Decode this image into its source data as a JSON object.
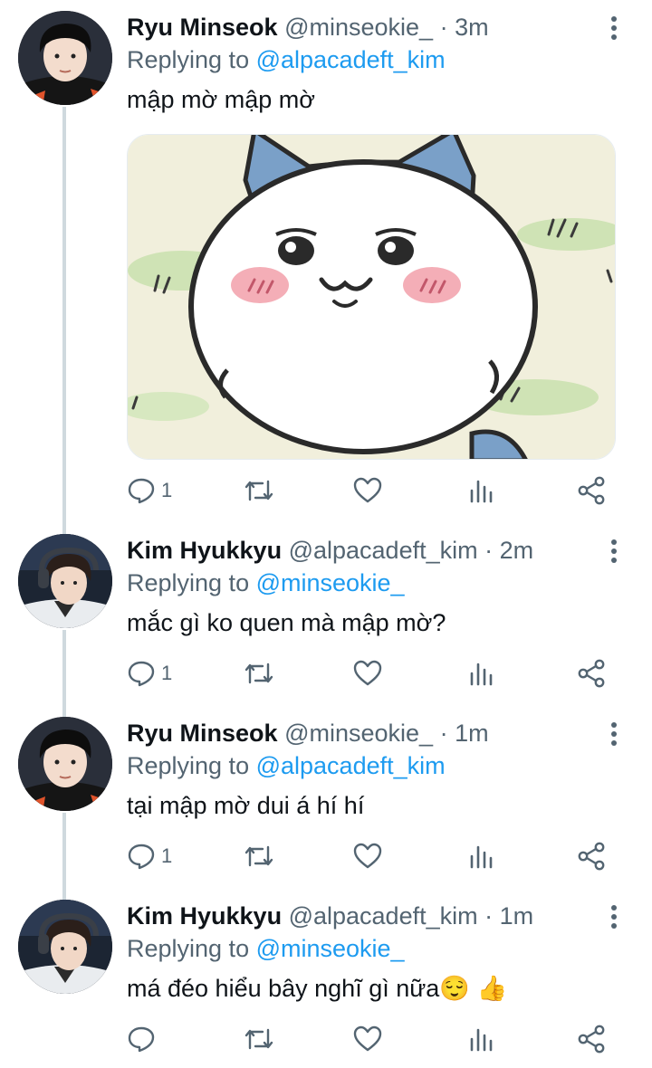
{
  "tweets": [
    {
      "name": "Ryu Minseok",
      "handle": "@minseokie_",
      "separator": "·",
      "time": "3m",
      "replying_prefix": "Replying to ",
      "replying_to": "@alpacadeft_kim",
      "text": "mập mờ mập mờ",
      "has_media": true,
      "reply_count": "1"
    },
    {
      "name": "Kim Hyukkyu",
      "handle": "@alpacadeft_kim",
      "separator": "·",
      "time": "2m",
      "replying_prefix": "Replying to ",
      "replying_to": "@minseokie_",
      "text": "mắc gì ko quen mà mập mờ?",
      "has_media": false,
      "reply_count": "1"
    },
    {
      "name": "Ryu Minseok",
      "handle": "@minseokie_",
      "separator": "·",
      "time": "1m",
      "replying_prefix": "Replying to ",
      "replying_to": "@alpacadeft_kim",
      "text": "tại mập mờ dui á hí hí",
      "has_media": false,
      "reply_count": "1"
    },
    {
      "name": "Kim Hyukkyu",
      "handle": "@alpacadeft_kim",
      "separator": "·",
      "time": "1m",
      "replying_prefix": "Replying to ",
      "replying_to": "@minseokie_",
      "text": "má đéo hiểu bây nghĩ gì nữa😌 👍",
      "has_media": false,
      "reply_count": ""
    }
  ],
  "icons": {
    "reply": "reply-icon",
    "retweet": "retweet-icon",
    "like": "heart-icon",
    "views": "analytics-icon",
    "share": "share-icon",
    "more": "more-vertical-icon"
  },
  "colors": {
    "text": "#0f1419",
    "secondary": "#536471",
    "accent": "#1d9bf0",
    "thread_line": "#cfd9de"
  }
}
